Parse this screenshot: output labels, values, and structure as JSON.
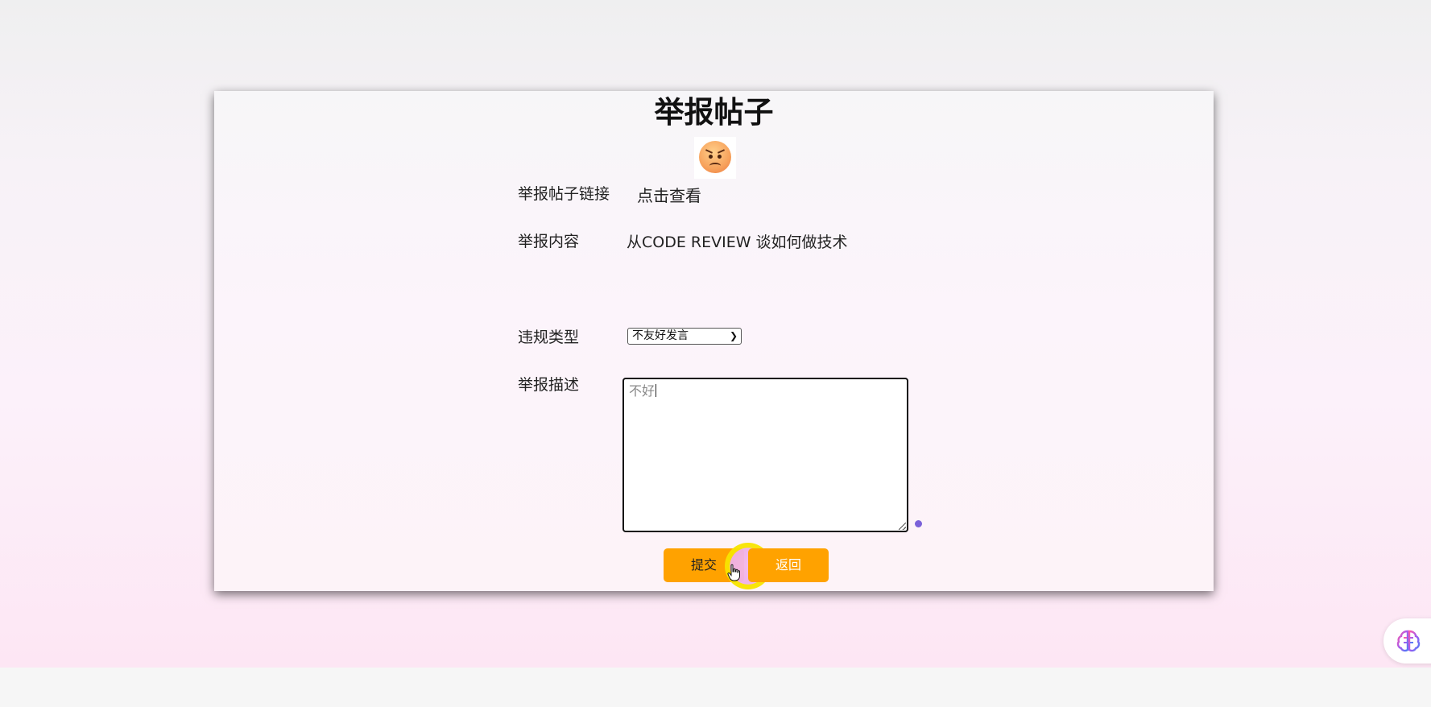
{
  "page": {
    "title": "举报帖子"
  },
  "form": {
    "link_label": "举报帖子链接",
    "link_value": "点击查看",
    "content_label": "举报内容",
    "content_value": "从CODE REVIEW 谈如何做技术",
    "type_label": "违规类型",
    "type_selected": "不友好发言",
    "description_label": "举报描述",
    "description_value": "不好"
  },
  "buttons": {
    "submit_label": "提交",
    "back_label": "返回"
  },
  "colors": {
    "button_bg": "#ffa200",
    "card_bg": "#f9f5f9",
    "accent_dot": "#7b61d9"
  },
  "icons": {
    "title_emoji": "angry-face-icon",
    "select_arrow": "chevron-down-icon",
    "side_widget": "brain-icon",
    "pointer": "hand-cursor-icon"
  }
}
